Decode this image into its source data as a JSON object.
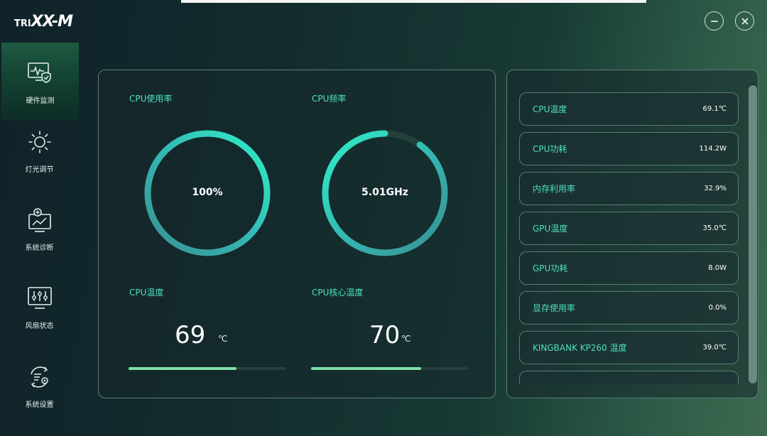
{
  "app": {
    "logo_small": "TRI",
    "logo_main": "XX-M"
  },
  "window_controls": {
    "minimize": "minimize-icon",
    "close": "close-icon"
  },
  "sidebar": {
    "items": [
      {
        "label": "硬件监测",
        "icon": "hardware-monitor-icon",
        "active": true
      },
      {
        "label": "灯光调节",
        "icon": "sun-icon",
        "active": false
      },
      {
        "label": "系统诊断",
        "icon": "diagnosis-icon",
        "active": false
      },
      {
        "label": "风扇状态",
        "icon": "fan-status-icon",
        "active": false
      },
      {
        "label": "系统设置",
        "icon": "settings-icon",
        "active": false
      }
    ]
  },
  "main": {
    "cpu_usage": {
      "title": "CPU使用率",
      "value_text": "100%",
      "fraction": 1.0
    },
    "cpu_freq": {
      "title": "CPU频率",
      "value_text": "5.01GHz",
      "fraction": 0.9
    },
    "cpu_temp": {
      "title": "CPU温度",
      "value": "69",
      "unit": "℃",
      "fraction": 0.69
    },
    "cpu_core_temp": {
      "title": "CPU核心温度",
      "value": "70",
      "unit": "℃",
      "fraction": 0.7
    }
  },
  "stats": [
    {
      "label": "CPU温度",
      "value": "69.1℃"
    },
    {
      "label": "CPU功耗",
      "value": "114.2W"
    },
    {
      "label": "内存利用率",
      "value": "32.9%"
    },
    {
      "label": "GPU温度",
      "value": "35.0℃"
    },
    {
      "label": "GPU功耗",
      "value": "8.0W"
    },
    {
      "label": "显存使用率",
      "value": "0.0%"
    },
    {
      "label": "KINGBANK KP260 温度",
      "value": "39.0℃"
    }
  ],
  "colors": {
    "accent": "#4ee0c0",
    "ring_start": "#3fa3a0",
    "ring_end": "#35e8c2",
    "bar_fill": "#7ee0a6",
    "nav_active": "#1d5a41"
  }
}
